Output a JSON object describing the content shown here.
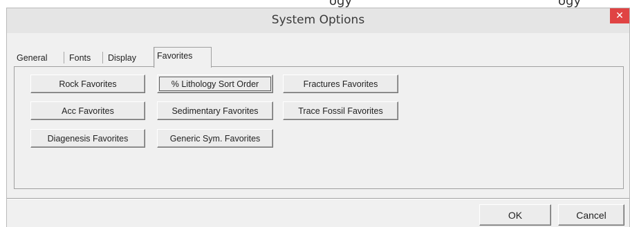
{
  "background_window": {
    "fragments": [
      "ogy",
      "ogy"
    ]
  },
  "window": {
    "title": "System Options",
    "close_glyph": "✕"
  },
  "tabs": [
    {
      "label": "General",
      "active": false
    },
    {
      "label": "Fonts",
      "active": false
    },
    {
      "label": "Display",
      "active": false
    },
    {
      "label": "Favorites",
      "active": true
    }
  ],
  "favorites": {
    "buttons": [
      {
        "label": "Rock Favorites"
      },
      {
        "label": "% Lithology Sort Order"
      },
      {
        "label": "Fractures Favorites"
      },
      {
        "label": "Acc Favorites"
      },
      {
        "label": "Sedimentary Favorites"
      },
      {
        "label": "Trace Fossil Favorites"
      },
      {
        "label": "Diagenesis Favorites"
      },
      {
        "label": "Generic Sym. Favorites"
      }
    ]
  },
  "footer": {
    "ok_label": "OK",
    "cancel_label": "Cancel"
  },
  "colors": {
    "close_button": "#e04343",
    "dialog_face": "#f0f0f0",
    "titlebar": "#e5e5e5"
  },
  "icons": {
    "close": "close-icon"
  }
}
